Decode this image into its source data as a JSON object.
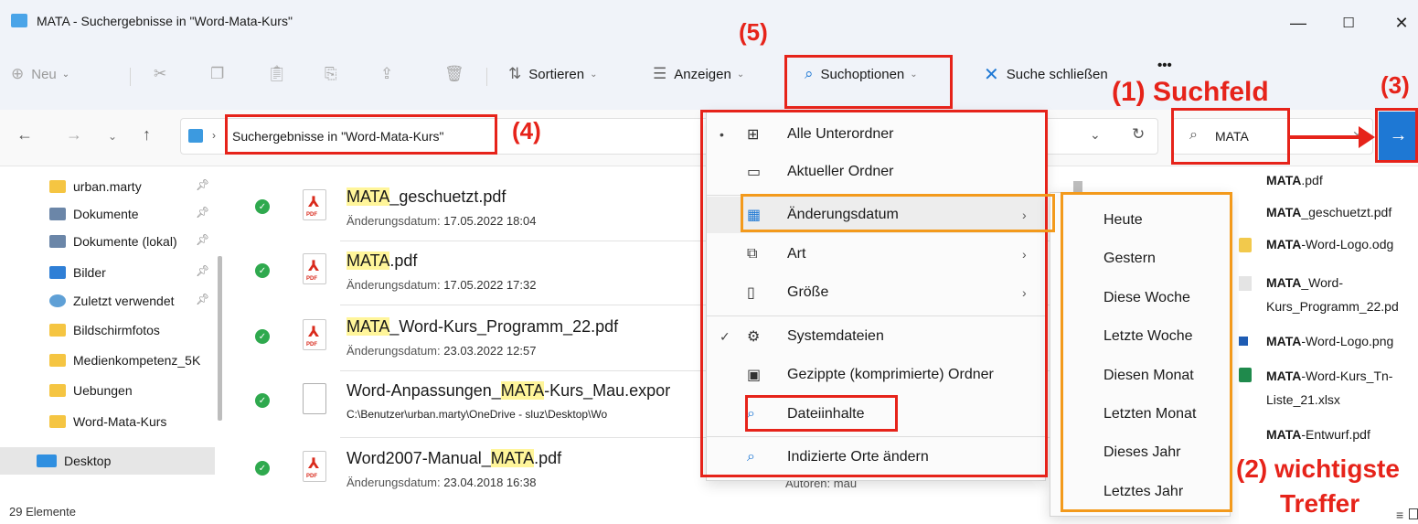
{
  "window": {
    "title": "MATA - Suchergebnisse in \"Word-Mata-Kurs\"",
    "controls": [
      "—",
      "☐",
      "✕"
    ]
  },
  "toolbar": {
    "new_label": "Neu",
    "sort_label": "Sortieren",
    "view_label": "Anzeigen",
    "search_options_label": "Suchoptionen",
    "close_search_label": "Suche schließen",
    "more_label": "•••"
  },
  "nav": {
    "breadcrumb": "Suchergebnisse in \"Word-Mata-Kurs\"",
    "search_value": "MATA"
  },
  "sidebar": {
    "items": [
      {
        "label": "urban.marty",
        "pinned": true
      },
      {
        "label": "Dokumente",
        "pinned": true
      },
      {
        "label": "Dokumente (lokal)",
        "pinned": true
      },
      {
        "label": "Bilder",
        "pinned": true
      },
      {
        "label": "Zuletzt verwendet",
        "pinned": true
      },
      {
        "label": "Bildschirmfotos",
        "pinned": false
      },
      {
        "label": "Medienkompetenz_5K",
        "pinned": false
      },
      {
        "label": "Uebungen",
        "pinned": false
      },
      {
        "label": "Word-Mata-Kurs",
        "pinned": false
      },
      {
        "label": "Desktop",
        "pinned": false
      }
    ]
  },
  "status": {
    "count": "29 Elemente"
  },
  "files": [
    {
      "pre": "",
      "hl": "MATA",
      "post": "_geschuetzt.pdf",
      "meta_label": "Änderungsdatum:",
      "meta_value": "17.05.2022 18:04"
    },
    {
      "pre": "",
      "hl": "MATA",
      "post": ".pdf",
      "meta_label": "Änderungsdatum:",
      "meta_value": "17.05.2022 17:32"
    },
    {
      "pre": "",
      "hl": "MATA",
      "post": "_Word-Kurs_Programm_22.pdf",
      "meta_label": "Änderungsdatum:",
      "meta_value": "23.03.2022 12:57"
    },
    {
      "pre": "Word-Anpassungen_",
      "hl": "MATA",
      "post": "-Kurs_Mau.expor",
      "meta_label": "",
      "meta_value": "C:\\Benutzer\\urban.marty\\OneDrive - sluz\\Desktop\\Wo"
    },
    {
      "pre": "Word2007-Manual_",
      "hl": "MATA",
      "post": ".pdf",
      "meta_label": "Änderungsdatum:",
      "meta_value": "23.04.2018 16:38",
      "extra": "Autoren: mau"
    }
  ],
  "menu": {
    "items": [
      {
        "label": "Alle Unterordner",
        "mark": "•",
        "icon": "subfolders-icon"
      },
      {
        "label": "Aktueller Ordner",
        "mark": "",
        "icon": "folder-icon"
      },
      {
        "label": "Änderungsdatum",
        "mark": "",
        "icon": "calendar-icon",
        "submenu": true
      },
      {
        "label": "Art",
        "mark": "",
        "icon": "kind-icon",
        "submenu": true
      },
      {
        "label": "Größe",
        "mark": "",
        "icon": "size-icon",
        "submenu": true
      },
      {
        "label": "Systemdateien",
        "mark": "✓",
        "icon": "system-file-icon"
      },
      {
        "label": "Gezippte (komprimierte) Ordner",
        "mark": "",
        "icon": "zip-folder-icon"
      },
      {
        "label": "Dateiinhalte",
        "mark": "",
        "icon": "file-search-icon"
      },
      {
        "label": "Indizierte Orte ändern",
        "mark": "",
        "icon": "index-icon"
      }
    ]
  },
  "submenu": {
    "items": [
      "Heute",
      "Gestern",
      "Diese Woche",
      "Letzte Woche",
      "Diesen Monat",
      "Letzten Monat",
      "Dieses Jahr",
      "Letztes Jahr"
    ]
  },
  "right_list": {
    "items": [
      {
        "bold": "MATA",
        "rest": ".pdf",
        "line2": ""
      },
      {
        "bold": "MATA",
        "rest": "_geschuetzt.pdf",
        "line2": ""
      },
      {
        "bold": "MATA",
        "rest": "-Word-Logo.odg",
        "line2": ""
      },
      {
        "bold": "MATA",
        "rest": "_Word-",
        "line2": "Kurs_Programm_22.pd"
      },
      {
        "bold": "MATA",
        "rest": "-Word-Logo.png",
        "line2": ""
      },
      {
        "bold": "MATA",
        "rest": "-Word-Kurs_Tn-",
        "line2": "Liste_21.xlsx"
      },
      {
        "bold": "MATA",
        "rest": "-Entwurf.pdf",
        "line2": ""
      }
    ]
  },
  "annotations": {
    "a1": "(1) Suchfeld",
    "a2_line1": "(2) wichtigste",
    "a2_line2": "Treffer",
    "a3": "(3)",
    "a4": "(4)",
    "a5": "(5)"
  },
  "colors": {
    "annotation_red": "#e6231a",
    "annotation_orange": "#f39a1c",
    "accent_blue": "#1e78d4"
  }
}
